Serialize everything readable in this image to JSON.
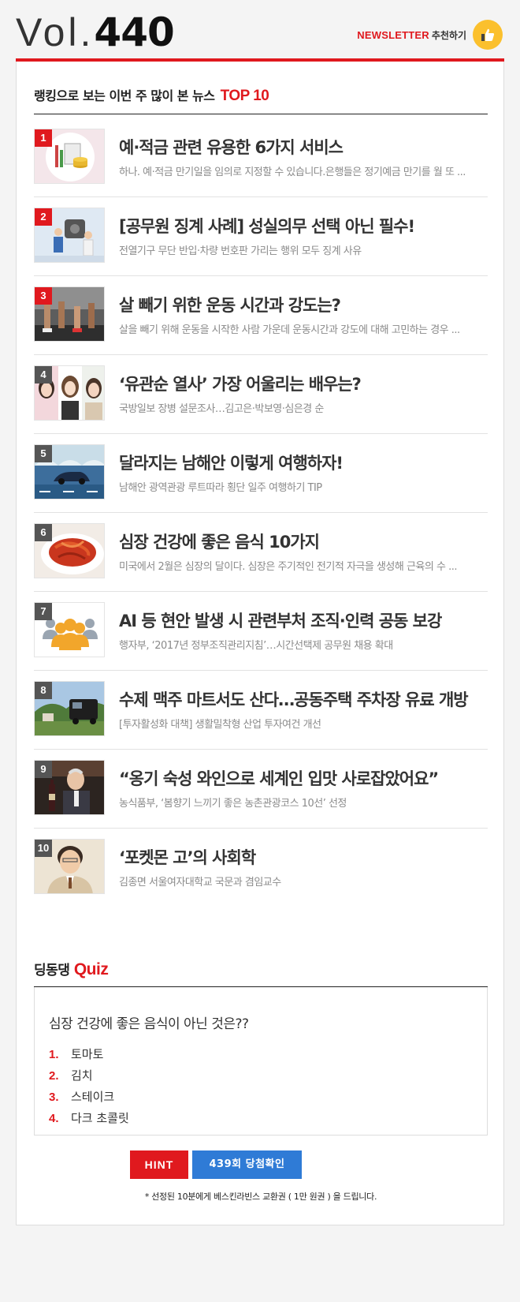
{
  "header": {
    "vol_label": "Vol.",
    "vol_number": "440",
    "newsletter_label": "NEWSLETTER",
    "recommend_label": "추천하기"
  },
  "ranking": {
    "title": "랭킹으로 보는 이번 주 많이 본 뉴스",
    "title_accent": "TOP 10",
    "items": [
      {
        "rank": "1",
        "title": "예·적금 관련 유용한 6가지 서비스",
        "desc": "하나. 예·적금 만기일을 임의로 지정할 수 있습니다.은행들은 정기예금 만기를 월 또 ..."
      },
      {
        "rank": "2",
        "title": "[공무원 징계 사례] 성실의무 선택 아닌 필수!",
        "desc": "전열기구 무단 반입·차량 번호판 가리는 행위 모두 징계 사유"
      },
      {
        "rank": "3",
        "title": "살 빼기 위한 운동 시간과 강도는?",
        "desc": "살을 빼기 위해 운동을 시작한 사람 가운데 운동시간과 강도에 대해 고민하는 경우 ..."
      },
      {
        "rank": "4",
        "title": "‘유관순 열사’ 가장 어울리는 배우는?",
        "desc": "국방일보 장병 설문조사…김고은·박보영·심은경 순"
      },
      {
        "rank": "5",
        "title": "달라지는 남해안 이렇게 여행하자!",
        "desc": "남해안 광역관광 루트따라 횡단 일주 여행하기 TIP"
      },
      {
        "rank": "6",
        "title": "심장 건강에 좋은 음식 10가지",
        "desc": "미국에서 2월은 심장의 달이다. 심장은 주기적인 전기적 자극을 생성해 근육의 수 ..."
      },
      {
        "rank": "7",
        "title": "AI 등 현안 발생 시 관련부처 조직·인력 공동 보강",
        "desc": "행자부, ‘2017년 정부조직관리지침’…시간선택제 공무원 채용 확대"
      },
      {
        "rank": "8",
        "title": "수제 맥주 마트서도 산다…공동주택 주차장 유료 개방",
        "desc": "[투자활성화 대책] 생활밀착형 산업 투자여건 개선"
      },
      {
        "rank": "9",
        "title": "“옹기 숙성 와인으로 세계인 입맛 사로잡았어요”",
        "desc": "농식품부, ‘봄향기 느끼기 좋은 농촌관광코스 10선’ 선정"
      },
      {
        "rank": "10",
        "title": "‘포켓몬 고’의 사회학",
        "desc": "김종면 서울여자대학교 국문과 겸임교수"
      }
    ]
  },
  "quiz": {
    "title": "딩동댕",
    "title_accent": "Quiz",
    "question": "심장 건강에 좋은 음식이 아닌 것은??",
    "options": [
      {
        "num": "1.",
        "text": "토마토"
      },
      {
        "num": "2.",
        "text": "김치"
      },
      {
        "num": "3.",
        "text": "스테이크"
      },
      {
        "num": "4.",
        "text": "다크 초콜릿"
      }
    ],
    "hint_button": "HINT",
    "check_button": "439회 당첨확인",
    "footnote": "* 선정된 10분에게 베스킨라빈스 교환권 ( 1만 원권 ) 을 드립니다."
  },
  "colors": {
    "accent_red": "#e0191e",
    "button_blue": "#2f7bd6",
    "thumb_yellow": "#fbc02d"
  }
}
